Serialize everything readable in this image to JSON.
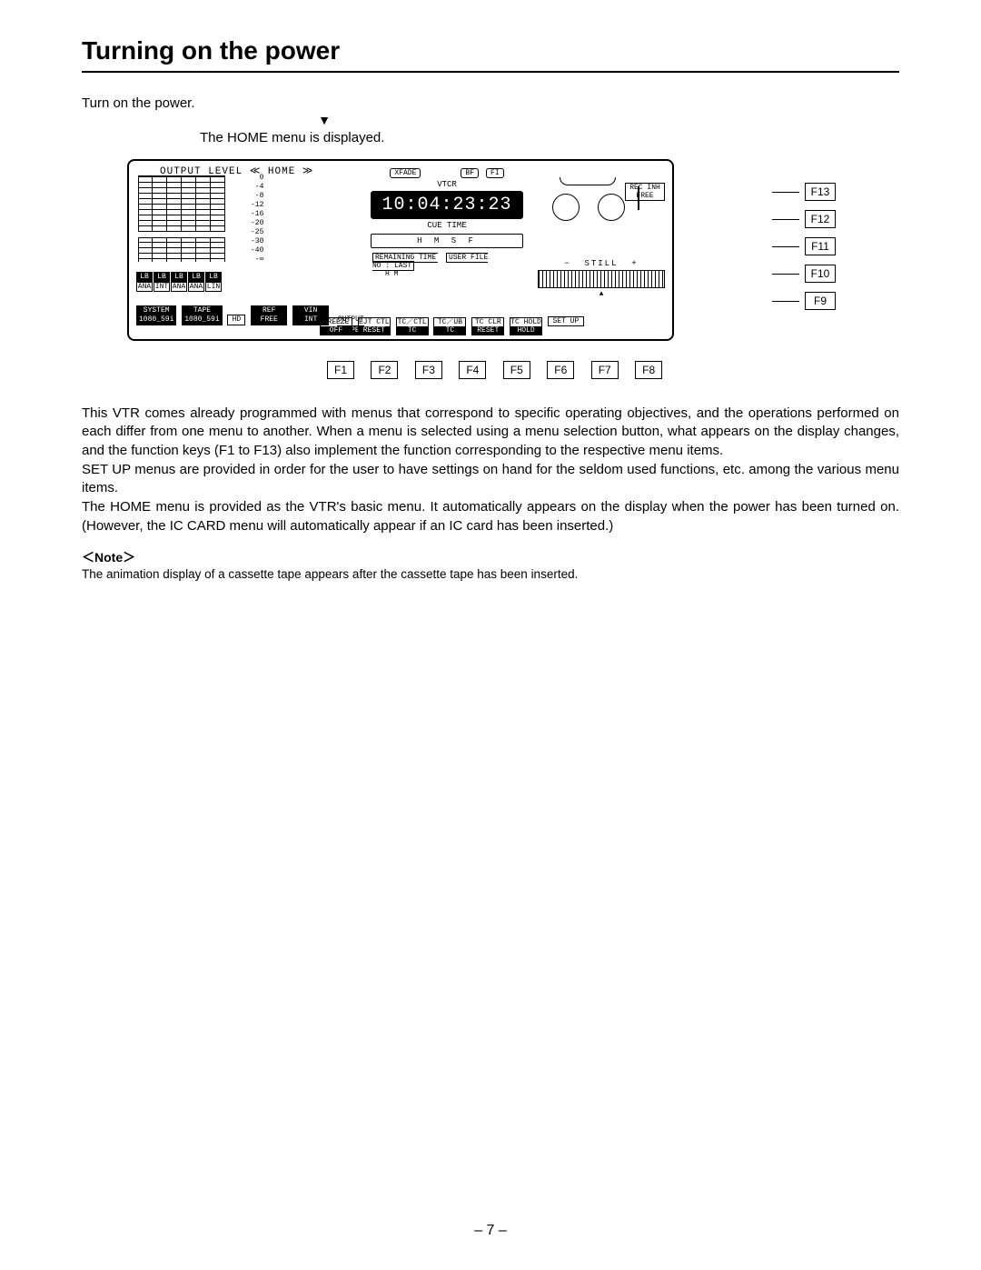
{
  "title": "Turning on the power",
  "step1": "Turn on the power.",
  "step2": "The HOME menu is displayed.",
  "lcd": {
    "header": "OUTPUT LEVEL   ≪ HOME ≫",
    "scale": [
      "0",
      "-4",
      "-8",
      "-12",
      "-16",
      "-20",
      "-25",
      "-30",
      "-40",
      "-∞"
    ],
    "chan_top": [
      "LB",
      "LB",
      "LB",
      "LB",
      "LB"
    ],
    "chan_bot": [
      "ANA",
      "INT",
      "ANA",
      "ANA",
      "LIN"
    ],
    "badges": [
      "XFADE",
      "BF",
      "FI"
    ],
    "vtcr": "VTCR",
    "timecode": "10:04:23:23",
    "cue": "CUE TIME",
    "hmsf": "H   M   S   F",
    "remaining": "REMAINING TIME",
    "hm": "H     M",
    "userfile": "USER FILE",
    "nolast": "NO : LAST",
    "rec_inh": "REC INH",
    "free": "FREE",
    "still": "STILL",
    "sys": [
      {
        "t": "SYSTEM",
        "b": "1080_59i"
      },
      {
        "t": "TAPE",
        "b": "1080_59i"
      },
      {
        "t": "",
        "b": "HD"
      },
      {
        "t": "REF",
        "b": "FREE"
      },
      {
        "t": "VIN",
        "b": "INT"
      }
    ],
    "output": "OUTPUT",
    "tape": "TAPE",
    "brow": [
      {
        "t": "FREEZE",
        "b": "OFF"
      },
      {
        "t": "EJT CTL",
        "b": "RESET"
      },
      {
        "t": "TC／CTL",
        "b": "TC"
      },
      {
        "t": "TC／UB",
        "b": "TC"
      },
      {
        "t": "TC CLR",
        "b": "RESET"
      },
      {
        "t": "TC HOLD",
        "b": "HOLD"
      },
      {
        "t": "",
        "b": "SET UP"
      }
    ]
  },
  "fkeys_bottom": [
    "F1",
    "F2",
    "F3",
    "F4",
    "F5",
    "F6",
    "F7",
    "F8"
  ],
  "fkeys_side": [
    "F13",
    "F12",
    "F11",
    "F10",
    "F9"
  ],
  "para1": "This VTR comes already programmed with menus that correspond to specific operating objectives, and the operations performed on each differ from one menu to another. When a menu is selected using a menu selection button, what appears on the display changes, and the function keys (F1 to F13) also implement the function corresponding to the respective menu items.",
  "para2": "SET UP menus are provided in order for the user to have settings on hand for the seldom used functions, etc. among the various menu items.",
  "para3": "The HOME menu is provided as the VTR's basic menu. It automatically appears on the display when the power has been turned on. (However, the IC CARD menu will automatically appear if an IC card has been inserted.)",
  "note_label": "＜Note＞",
  "note_text": "The animation display of a cassette tape appears after the cassette tape has been inserted.",
  "page_number": "– 7 –"
}
